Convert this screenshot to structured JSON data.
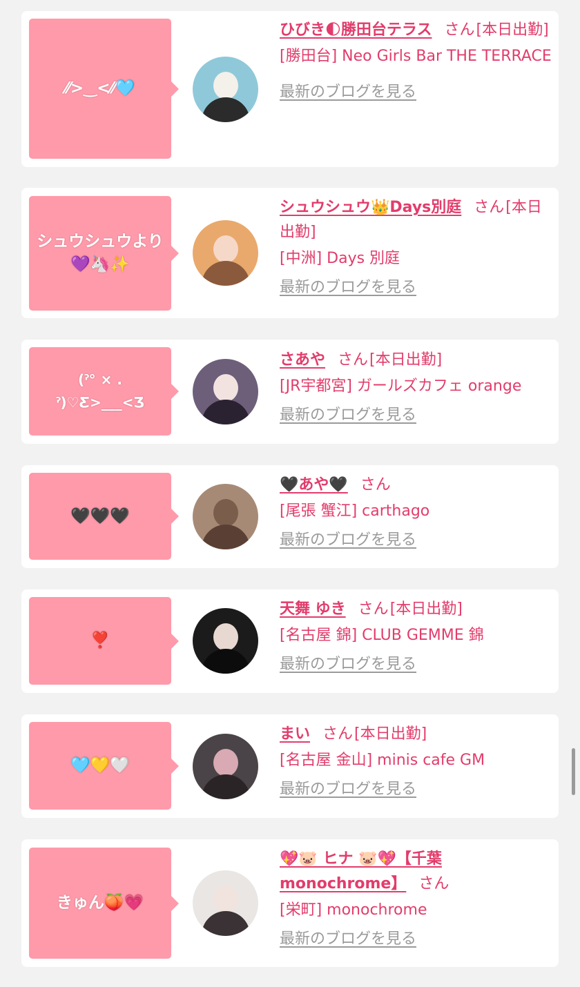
{
  "entries": [
    {
      "bubble": "⁄⁄>‿<⁄⁄🩵",
      "name": "ひびき🌓勝田台テラス",
      "san": "さん",
      "status": "[本日出勤]",
      "shop": "[勝田台] Neo Girls Bar THE TERRACE",
      "blog": "最新のブログを見る",
      "avatar_colors": [
        "#8fc9d9",
        "#f4f0ea",
        "#2b2b2b"
      ]
    },
    {
      "bubble": "シュウシュウより💜🦄✨",
      "name": "シュウシュウ👑Days別庭",
      "san": "さん",
      "status": "[本日出勤]",
      "shop": "[中洲] Days 別庭",
      "blog": "最新のブログを見る",
      "avatar_colors": [
        "#e9a96c",
        "#f6d8c8",
        "#8b5a3c"
      ]
    },
    {
      "bubble": "(ˀ° × . ˀ)♡Ƹ>___<Ʒ",
      "name": "さあや",
      "san": "さん",
      "status": "[本日出勤]",
      "shop": "[JR宇都宮] ガールズカフェ orange",
      "blog": "最新のブログを見る",
      "avatar_colors": [
        "#6d5f7a",
        "#f3e3e0",
        "#2a2230"
      ]
    },
    {
      "bubble": "🖤🖤🖤",
      "name": "🖤あや🖤",
      "san": "さん",
      "status": "",
      "shop": "[尾張 蟹江] carthago",
      "blog": "最新のブログを見る",
      "avatar_colors": [
        "#a78a76",
        "#7a5d4b",
        "#5a4034"
      ]
    },
    {
      "bubble": "❣️",
      "name": "天舞 ゆき",
      "san": "さん",
      "status": "[本日出勤]",
      "shop": "[名古屋 錦] CLUB GEMME 錦",
      "blog": "最新のブログを見る",
      "avatar_colors": [
        "#1b1b1b",
        "#e8d8d2",
        "#0c0c0c"
      ]
    },
    {
      "bubble": "🩵💛🤍",
      "name": "まい",
      "san": "さん",
      "status": "[本日出勤]",
      "shop": "[名古屋 金山] minis cafe GM",
      "blog": "最新のブログを見る",
      "avatar_colors": [
        "#4a4448",
        "#d9a9b4",
        "#2a2426"
      ]
    },
    {
      "bubble": "きゅん🍑💗",
      "name": "💖🐷 ヒナ 🐷💖【千葉monochrome】",
      "san": "さん",
      "status": "",
      "shop": "[栄町] monochrome",
      "blog": "最新のブログを見る",
      "avatar_colors": [
        "#e9e6e4",
        "#f1e4df",
        "#3a3234"
      ]
    }
  ],
  "colors": {
    "accent": "#e23c6b",
    "bubble": "#ff9aaa",
    "link_gray": "#9a9a9a",
    "background": "#f2f2f2"
  }
}
